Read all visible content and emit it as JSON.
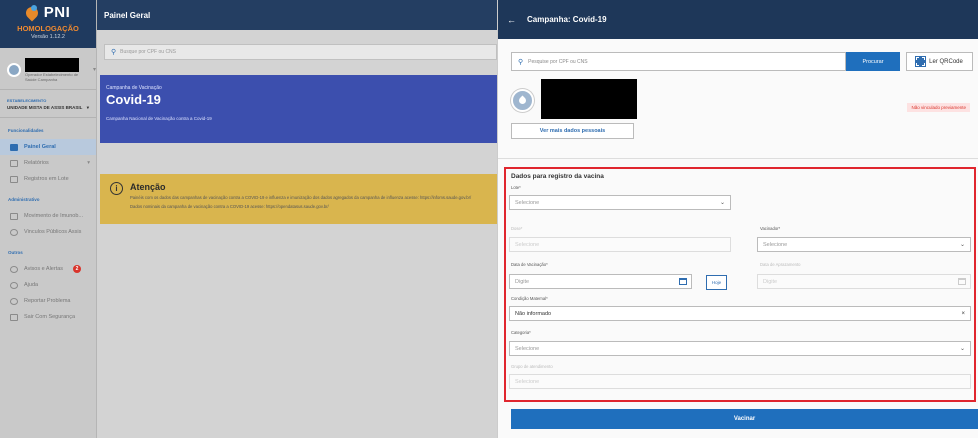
{
  "sidebar": {
    "logo": "PNI",
    "env": "HOMOLOGAÇÃO",
    "version": "Versão 1.12.2",
    "user_sub": "Operador Estabelecimento de Saúde Campanha",
    "estab_label": "ESTABELECIMENTO",
    "estab_name": "UNIDADE MISTA DE ASSIS BRASIL",
    "section_funcionalidades": "Funcionalidades",
    "section_administrativo": "Administrativo",
    "section_outros": "Outros",
    "items": {
      "painel": "Painel Geral",
      "relatorios": "Relatórios",
      "registros_lote": "Registros em Lote",
      "movimento": "Movimento de Imunob...",
      "vinculos": "Vinculos Públicos Assis",
      "avisos": "Avisos e Alertas",
      "avisos_count": "2",
      "ajuda": "Ajuda",
      "reportar": "Reportar Problema",
      "sair": "Sair Com Segurança"
    }
  },
  "main": {
    "title": "Painel Geral",
    "search_placeholder": "Busque por CPF ou CNS",
    "campaign_label": "Campanha de Vacinação",
    "campaign_title": "Covid-19",
    "campaign_sub": "Campanha Nacional de Vacinação contra a Covid-19",
    "alert_title": "Atenção",
    "alert_line1": "Painéis com os dados das campanhas de vacinação contra a COVID-19 e influenza e imunização dos dados agregados da campanha de influenza acesse: https://infoms.saude.gov.br/",
    "alert_line2": "Dados nominais da campanha de vacinação contra a COVID-19 acesse: https://opendatasus.saude.gov.br/"
  },
  "drawer": {
    "title": "Campanha: Covid-19",
    "search_placeholder": "Pesquise por CPF ou CNS",
    "search_button": "Procurar",
    "qr_button": "Ler QRCode",
    "more_button": "Ver mais dados pessoais",
    "status_tag": "Não vinculado previamente",
    "form_title": "Dados para registro da vacina",
    "lote_label": "Lote*",
    "lote_value": "Selecione",
    "dose_label": "Dose*",
    "dose_value": "Selecione",
    "vacinador_label": "Vacinador*",
    "vacinador_value": "Selecione",
    "data_vac_label": "Data de Vacinação*",
    "data_vac_value": "Digite",
    "hoje_button": "Hoje",
    "data_apraz_label": "Data de Aprazamento",
    "data_apraz_value": "Digite",
    "cond_label": "Condição Maternal*",
    "cond_value": "Não informado",
    "cat_label": "Categoria*",
    "cat_value": "Selecione",
    "grupo_label": "Grupo de atendimento",
    "grupo_value": "Selecione",
    "vacinar_button": "Vacinar"
  }
}
